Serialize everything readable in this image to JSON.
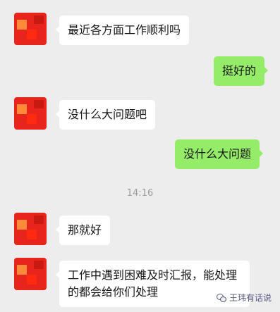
{
  "messages": [
    {
      "side": "left",
      "text": "最近各方面工作顺利吗"
    },
    {
      "side": "right",
      "text": "挺好的"
    },
    {
      "side": "left",
      "text": "没什么大问题吧"
    },
    {
      "side": "right",
      "text": "没什么大问题"
    },
    {
      "side": "left",
      "text": "那就好"
    },
    {
      "side": "left",
      "line1": "工作中遇到困难及时汇报，能处理",
      "line2": "的都会给你们处理"
    }
  ],
  "timestamp": "14:16",
  "watermark": "王玮有话说",
  "colors": {
    "background": "#ededed",
    "left_bubble": "#ffffff",
    "right_bubble": "#95ec69",
    "avatar": "#e8251c"
  }
}
